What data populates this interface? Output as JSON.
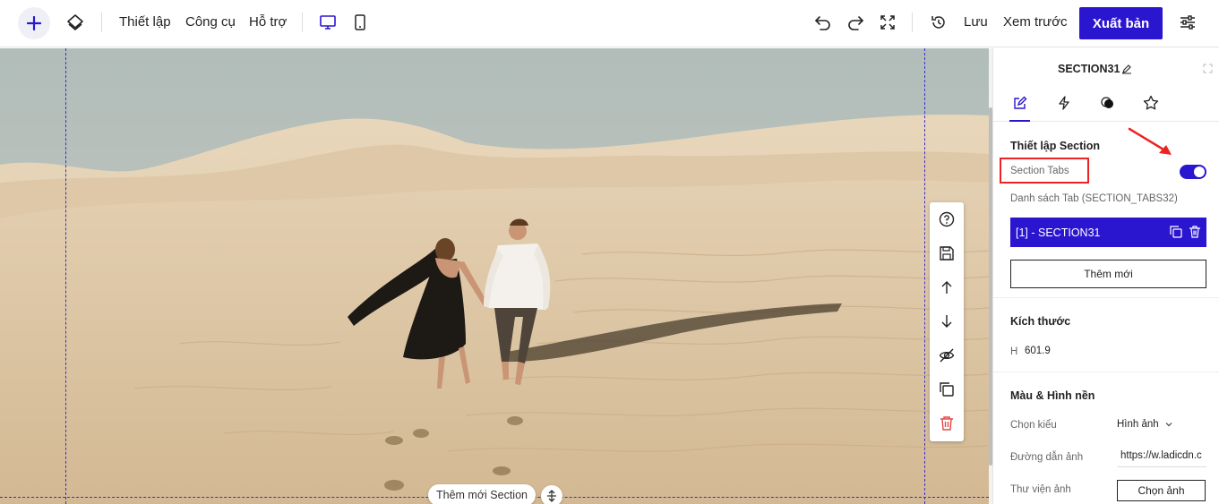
{
  "topbar": {
    "menu": [
      "Thiết lập",
      "Công cụ",
      "Hỗ trợ"
    ],
    "save_label": "Lưu",
    "preview_label": "Xem trước",
    "publish_label": "Xuất bản"
  },
  "canvas": {
    "add_section_label": "Thêm mới Section"
  },
  "panel": {
    "title": "SECTION31",
    "tabs": [
      "style-tab",
      "action-tab",
      "effect-tab",
      "favorite-tab"
    ],
    "section_settings": {
      "heading": "Thiết lập Section",
      "section_tabs_label": "Section Tabs",
      "section_tabs_enabled": true,
      "tab_list_label": "Danh sách Tab (SECTION_TABS32)",
      "tab_items": [
        "[1] - SECTION31"
      ],
      "add_new_label": "Thêm mới"
    },
    "size": {
      "heading": "Kích thước",
      "h_label": "H",
      "h_value": "601.9"
    },
    "background": {
      "heading": "Màu & Hình nền",
      "choose_type_label": "Chọn kiểu",
      "choose_type_value": "Hình ảnh",
      "image_path_label": "Đường dẫn ảnh",
      "image_path_value": "https://w.ladicdn.c",
      "library_label": "Thư viện ảnh",
      "choose_image_label": "Chọn ảnh"
    }
  },
  "colors": {
    "accent": "#2b16d0",
    "highlight": "#e22222"
  }
}
